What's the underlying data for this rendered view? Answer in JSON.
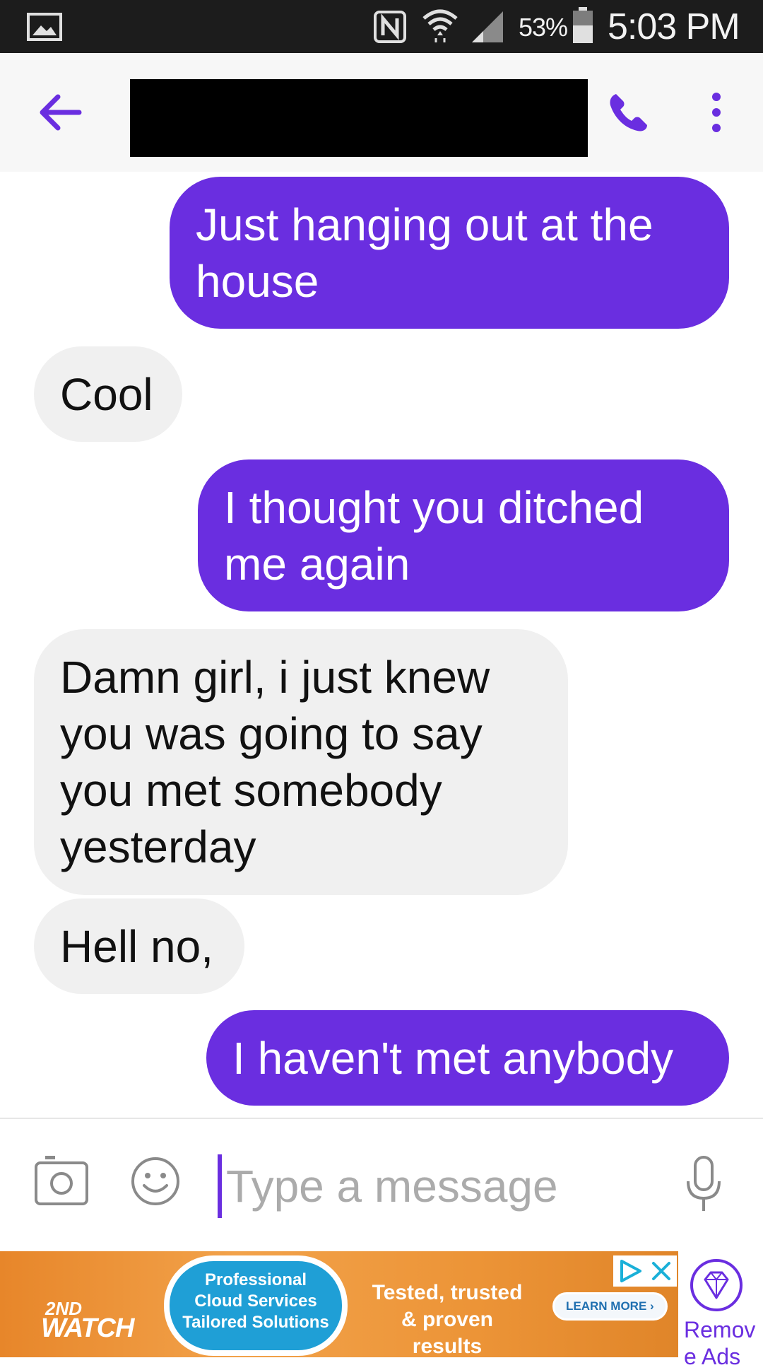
{
  "status_bar": {
    "battery_percent": "53%",
    "time": "5:03 PM",
    "icons": [
      "gallery-icon",
      "nfc-icon",
      "wifi-icon",
      "signal-icon",
      "battery-icon"
    ]
  },
  "app_bar": {
    "contact_name": "",
    "icons": [
      "back-arrow-icon",
      "phone-icon",
      "more-vert-icon"
    ],
    "accent_color": "#6a2ee0"
  },
  "messages": [
    {
      "direction": "outgoing",
      "text": "Just hanging out at the house"
    },
    {
      "direction": "incoming",
      "text": "Cool"
    },
    {
      "direction": "outgoing",
      "text": "I thought you ditched me again"
    },
    {
      "direction": "incoming",
      "text": "Damn girl, i just knew you was going to say you met somebody yesterday"
    },
    {
      "direction": "incoming",
      "text": "Hell no,"
    },
    {
      "direction": "outgoing",
      "text": "I haven't met anybody"
    }
  ],
  "colors": {
    "outgoing_bubble": "#6a2ee0",
    "incoming_bubble": "#f0f0f0"
  },
  "composer": {
    "placeholder": "Type a message",
    "value": "",
    "icons": [
      "camera-icon",
      "emoji-icon",
      "microphone-icon"
    ]
  },
  "ad": {
    "brand": "WATCH",
    "brand_prefix": "2ND",
    "cloud_text": [
      "Professional",
      "Cloud Services",
      "Tailored Solutions"
    ],
    "tagline": [
      "Tested, trusted",
      "& proven results"
    ],
    "cta": "LEARN MORE",
    "icons": [
      "ad-choices-icon",
      "close-icon"
    ],
    "remove_label": "Remove Ads",
    "remove_icon": "diamond-icon"
  }
}
